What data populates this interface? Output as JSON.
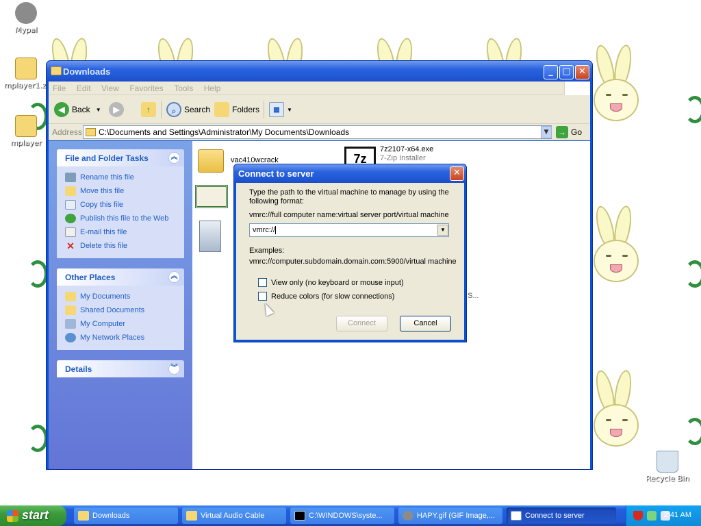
{
  "desktop": {
    "icons": [
      {
        "label": "Mypal",
        "icon": "raccoon-icon"
      },
      {
        "label": "mplayer1.zi",
        "icon": "zip-folder-icon"
      },
      {
        "label": "mplayer",
        "icon": "folder-icon"
      },
      {
        "label": "Recycle Bin",
        "icon": "recycle-bin-icon"
      }
    ]
  },
  "explorer": {
    "title": "Downloads",
    "menu": [
      "File",
      "Edit",
      "View",
      "Favorites",
      "Tools",
      "Help"
    ],
    "toolbar": {
      "back": "Back",
      "search": "Search",
      "folders": "Folders"
    },
    "address": {
      "label": "Address",
      "value": "C:\\Documents and Settings\\Administrator\\My Documents\\Downloads",
      "go": "Go"
    },
    "tasks_panel": {
      "title": "File and Folder Tasks",
      "items": [
        "Rename this file",
        "Move this file",
        "Copy this file",
        "Publish this file to the Web",
        "E-mail this file",
        "Delete this file"
      ]
    },
    "places_panel": {
      "title": "Other Places",
      "items": [
        "My Documents",
        "Shared Documents",
        "My Computer",
        "My Network Places"
      ]
    },
    "details_panel": {
      "title": "Details"
    },
    "files": [
      {
        "name": "vac410wcrack",
        "sub": "",
        "icon": "folder-icon"
      },
      {
        "name": "7z2107-x64.exe",
        "sub": "7-Zip Installer",
        "icon": "7zip-icon"
      },
      {
        "name": "",
        "sub": "",
        "icon": "certificate-icon"
      },
      {
        "name": "",
        "sub": "",
        "icon": "installer-icon"
      },
      {
        "name": "t S...",
        "sub": "",
        "icon": ""
      }
    ]
  },
  "dialog": {
    "title": "Connect to server",
    "instruction": "Type the path to the virtual machine to manage by using the following format:",
    "format": "vmrc://full computer name:virtual server port/virtual machine",
    "input_value": "vmrc://",
    "examples_label": "Examples:",
    "example": "vmrc://computer.subdomain.domain.com:5900/virtual machine",
    "checkbox_view_only": "View only (no keyboard or mouse input)",
    "checkbox_reduce_colors": "Reduce colors (for slow connections)",
    "connect_button": "Connect",
    "cancel_button": "Cancel"
  },
  "taskbar": {
    "start": "start",
    "tasks": [
      {
        "label": "Downloads",
        "active": false
      },
      {
        "label": "Virtual Audio Cable",
        "active": false
      },
      {
        "label": "C:\\WINDOWS\\syste...",
        "active": false
      },
      {
        "label": "HAPY.gif (GIF Image,...",
        "active": false
      },
      {
        "label": "Connect to server",
        "active": true
      }
    ],
    "clock": "2:41 AM"
  },
  "colors": {
    "xp_blue": "#0a53d4",
    "task_link": "#215dc6",
    "taskbar": "#245edb",
    "start_green": "#3c9a3c"
  }
}
